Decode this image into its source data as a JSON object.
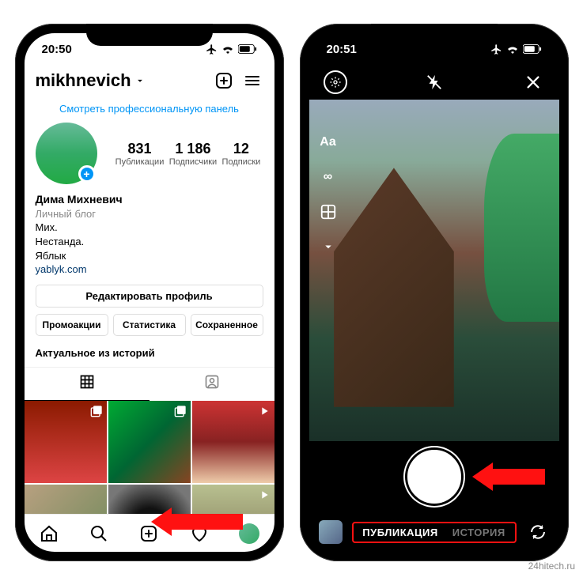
{
  "status": {
    "time_left": "20:50",
    "time_right": "20:51"
  },
  "profile": {
    "username": "mikhnevich",
    "promo_panel": "Смотреть профессиональную панель",
    "stats": {
      "posts_n": "831",
      "posts_l": "Публикации",
      "followers_n": "1 186",
      "followers_l": "Подписчики",
      "following_n": "12",
      "following_l": "Подписки"
    },
    "bio": {
      "name": "Дима Михневич",
      "category": "Личный блог",
      "line1": "Мих.",
      "line2": "Нестанда.",
      "line3": "Яблык",
      "link": "yablyk.com"
    },
    "edit_btn": "Редактировать профиль",
    "btns": {
      "promo": "Промоакции",
      "stats": "Статистика",
      "saved": "Сохраненное"
    },
    "highlights": "Актуальное из историй"
  },
  "camera": {
    "text_tool": "Aa",
    "infinity": "∞",
    "mode_publication": "ПУБЛИКАЦИЯ",
    "mode_story": "ИСТОРИЯ"
  },
  "watermark": "24hitech.ru"
}
